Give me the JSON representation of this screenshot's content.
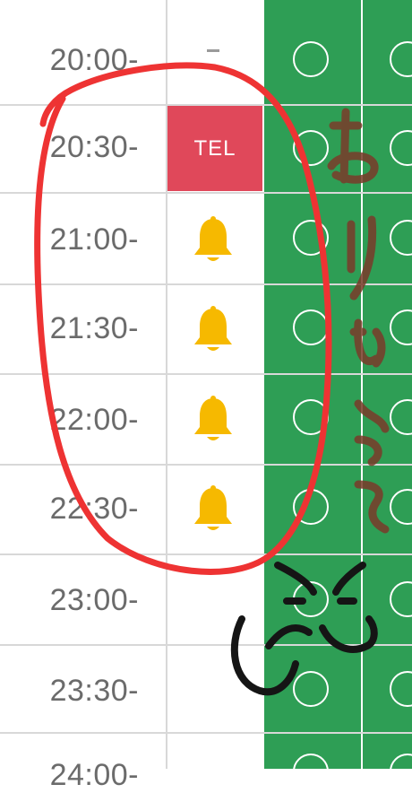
{
  "rows": [
    {
      "time": "20:00-",
      "status": "-"
    },
    {
      "time": "20:30-",
      "status": "TEL"
    },
    {
      "time": "21:00-",
      "status": "bell-icon"
    },
    {
      "time": "21:30-",
      "status": "bell-icon"
    },
    {
      "time": "22:00-",
      "status": "bell-icon"
    },
    {
      "time": "22:30-",
      "status": "bell-icon"
    },
    {
      "time": "23:00-",
      "status": "available"
    },
    {
      "time": "23:30-",
      "status": "available"
    },
    {
      "time": "24:00-",
      "status": "available"
    }
  ],
  "tel_label": "TEL",
  "dash_label": "-",
  "colors": {
    "green": "#2e9e55",
    "tel_red": "#e0485a",
    "bell_yellow": "#f6b900",
    "annotation_red": "#ee3333",
    "annotation_brown": "#7a3b2a"
  },
  "annotation": {
    "handwritten_text": "ありがとう",
    "doodle": "smiley-doodle"
  }
}
